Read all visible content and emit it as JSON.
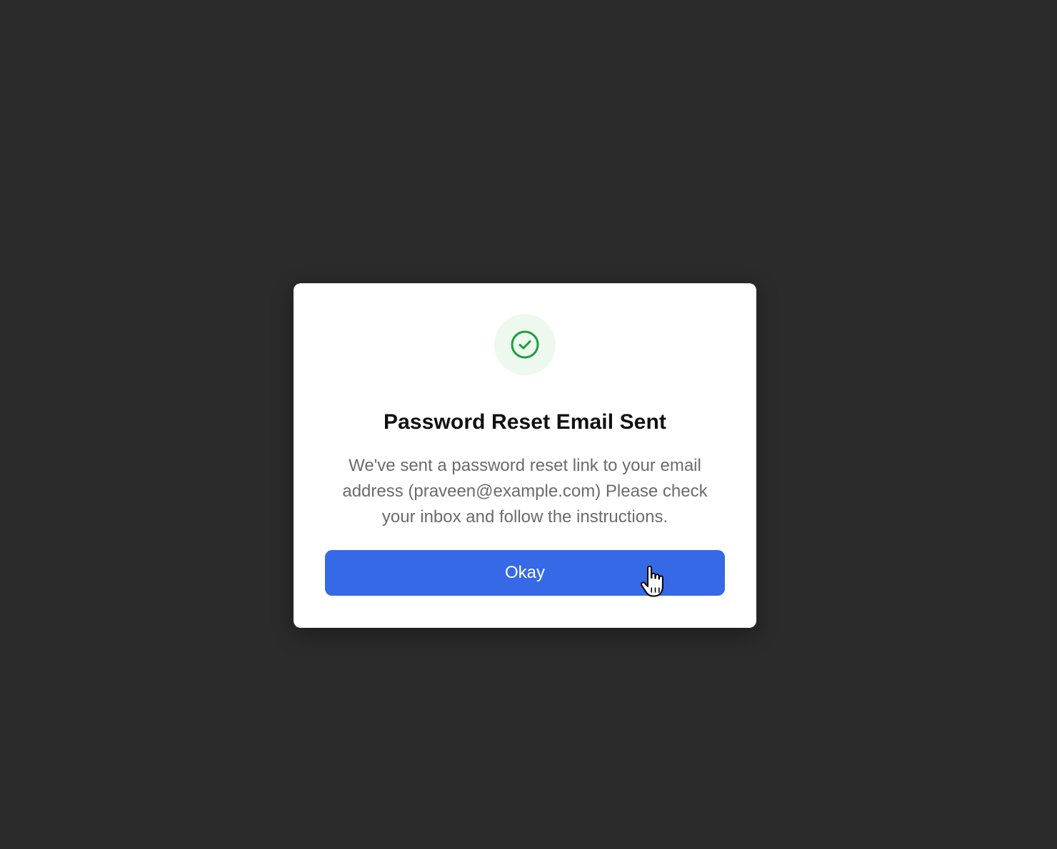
{
  "dialog": {
    "title": "Password Reset Email Sent",
    "message": "We've sent a password reset link to your email address (praveen@example.com) Please check your inbox and follow the instructions.",
    "okay_label": "Okay",
    "icon": "check-circle-icon"
  },
  "colors": {
    "backdrop": "#2b2b2b",
    "primary": "#3669e6",
    "success": "#1f9d3a",
    "success_bg": "#edf9ef"
  }
}
